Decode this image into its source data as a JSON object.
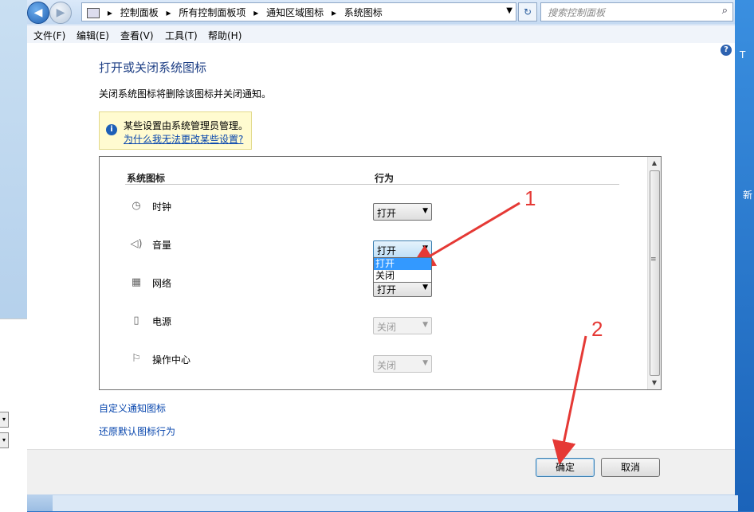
{
  "address_bar": {
    "crumbs": [
      "控制面板",
      "所有控制面板项",
      "通知区域图标",
      "系统图标"
    ],
    "search_placeholder": "搜索控制面板"
  },
  "menu": [
    "文件(F)",
    "编辑(E)",
    "查看(V)",
    "工具(T)",
    "帮助(H)"
  ],
  "page": {
    "title": "打开或关闭系统图标",
    "description": "关闭系统图标将删除该图标并关闭通知。",
    "info_text": "某些设置由系统管理员管理。",
    "info_link": "为什么我无法更改某些设置?"
  },
  "table": {
    "col_icon": "系统图标",
    "col_behavior": "行为",
    "rows": [
      {
        "label": "时钟",
        "icon": "clock-icon",
        "value": "打开",
        "enabled": true
      },
      {
        "label": "音量",
        "icon": "speaker-icon",
        "value": "打开",
        "enabled": true
      },
      {
        "label": "网络",
        "icon": "network-icon",
        "value": "打开",
        "enabled": true
      },
      {
        "label": "电源",
        "icon": "power-icon",
        "value": "关闭",
        "enabled": false
      },
      {
        "label": "操作中心",
        "icon": "flag-icon",
        "value": "关闭",
        "enabled": false
      }
    ],
    "dropdown_options": [
      "打开",
      "关闭"
    ]
  },
  "links": {
    "customize": "自定义通知图标",
    "restore": "还原默认图标行为"
  },
  "buttons": {
    "ok": "确定",
    "cancel": "取消"
  },
  "annotations": {
    "step1": "1",
    "step2": "2",
    "color": "#e53935"
  },
  "desktop": {
    "right_text_1": "T",
    "right_text_2": "新"
  }
}
